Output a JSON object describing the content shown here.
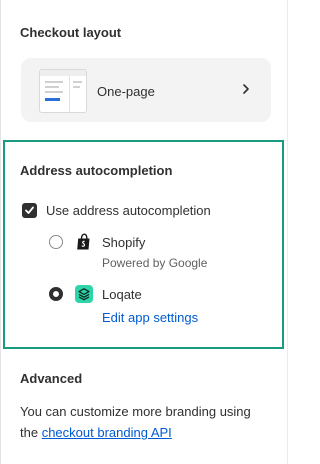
{
  "checkout_layout": {
    "heading": "Checkout layout",
    "option_label": "One-page",
    "icon": "chevron-right-icon"
  },
  "address_autocompletion": {
    "heading": "Address autocompletion",
    "checkbox_label": "Use address autocompletion",
    "checkbox_checked": true,
    "providers": [
      {
        "name": "Shopify",
        "subtitle": "Powered by Google",
        "selected": false,
        "icon": "shopify-bag-icon"
      },
      {
        "name": "Loqate",
        "link": "Edit app settings",
        "selected": true,
        "icon": "loqate-icon"
      }
    ]
  },
  "advanced": {
    "heading": "Advanced",
    "text": "You can customize more branding using the",
    "link_text": "checkout branding API"
  },
  "colors": {
    "highlight": "#1a9a7e",
    "link": "#005bd3",
    "loqate": "#2fd4a8"
  }
}
